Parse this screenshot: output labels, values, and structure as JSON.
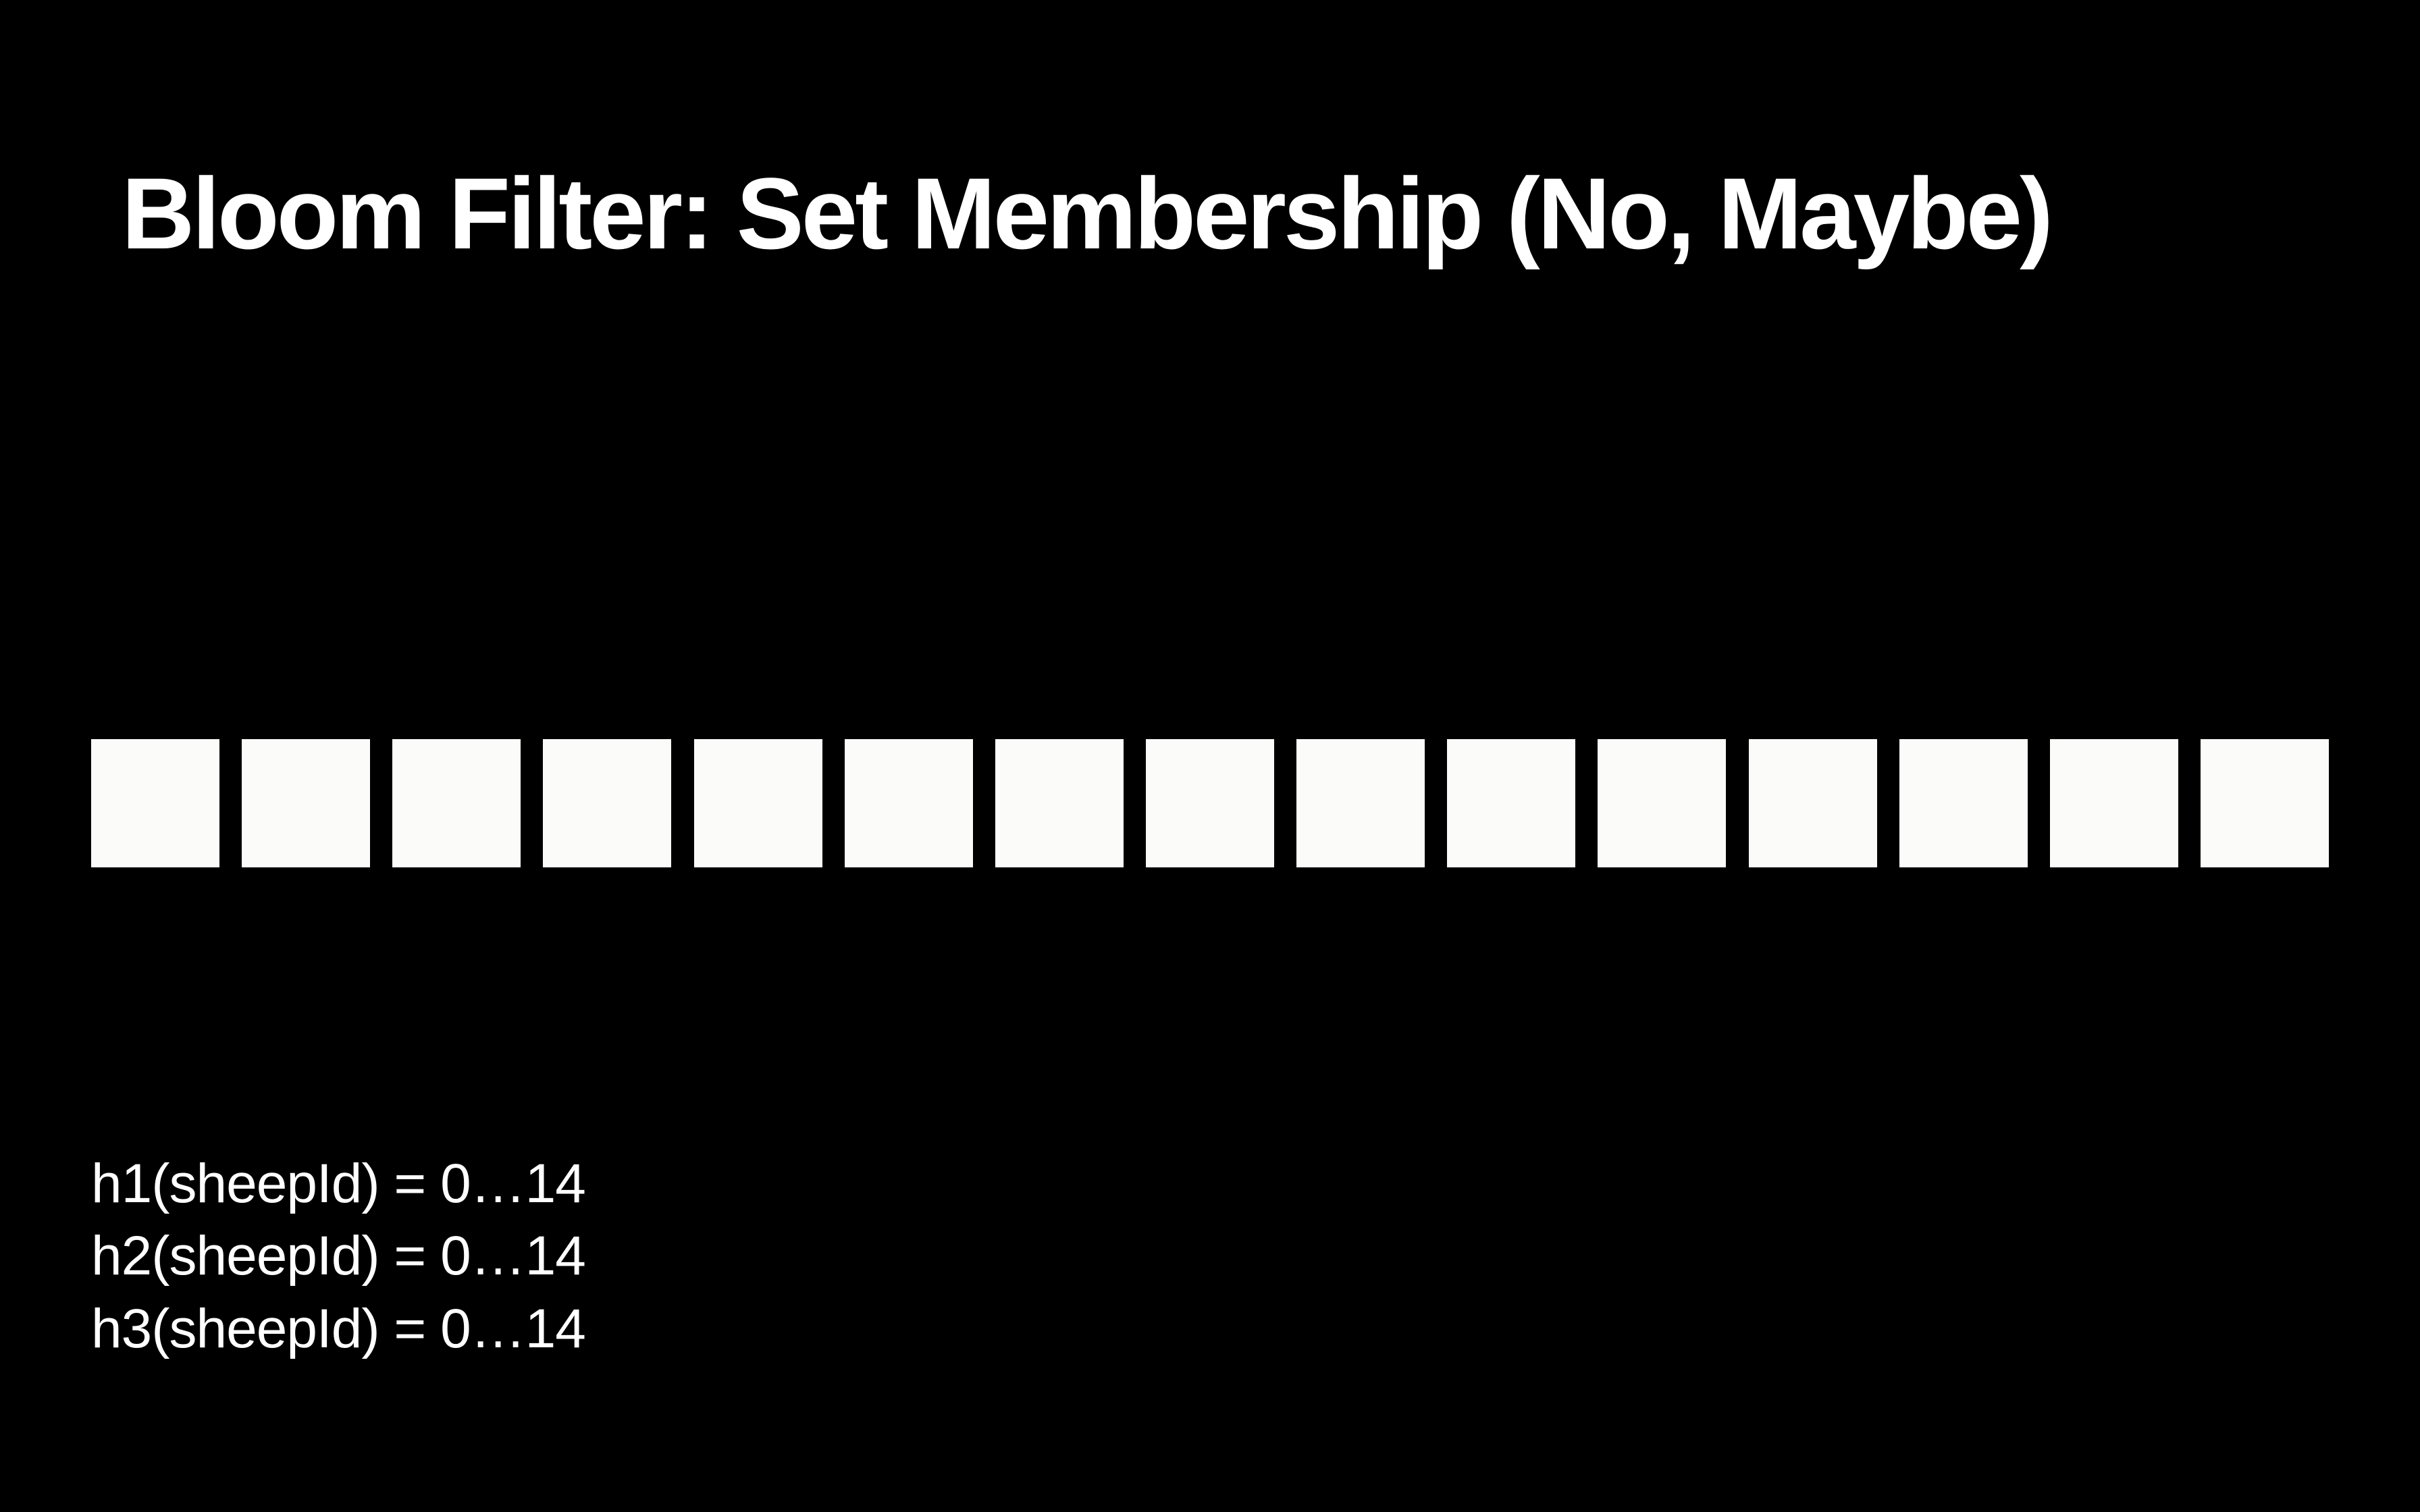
{
  "title": "Bloom Filter: Set Membership (No, Maybe)",
  "bit_array": {
    "count": 15,
    "cell_color": "#fbfbf9"
  },
  "hash_functions": [
    "h1(sheepId) = 0…14",
    "h2(sheepId) = 0…14",
    "h3(sheepId) = 0…14"
  ]
}
